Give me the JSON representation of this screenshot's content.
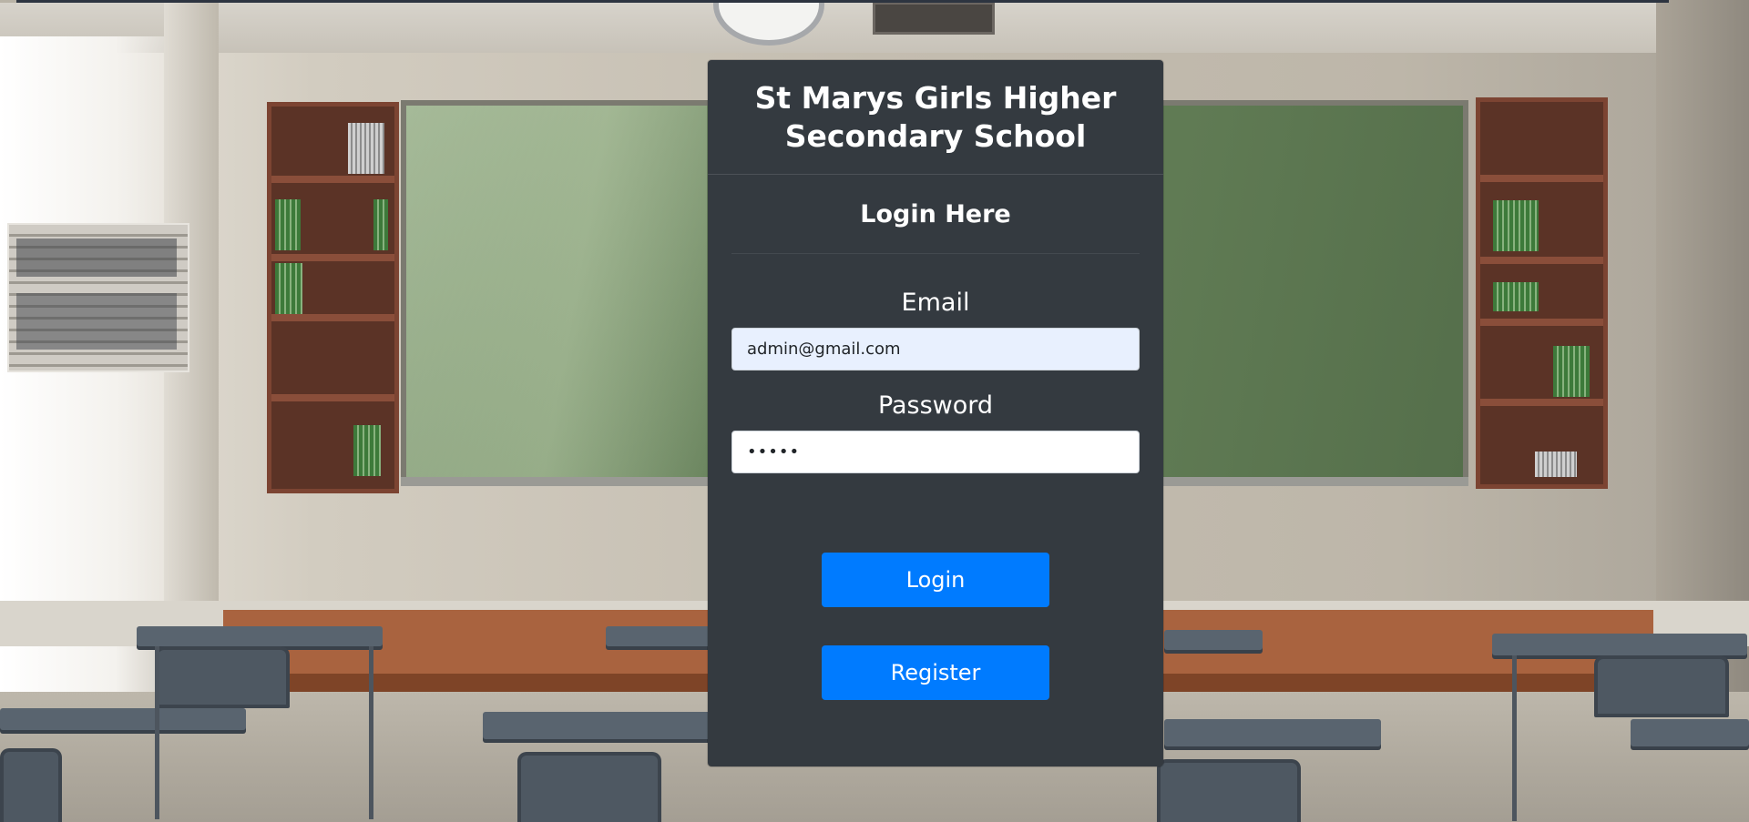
{
  "header": {
    "school_name": "St Marys Girls Higher Secondary School"
  },
  "login": {
    "heading": "Login Here",
    "email_label": "Email",
    "email_value": "admin@gmail.com",
    "password_label": "Password",
    "password_value": "•••••",
    "login_button": "Login",
    "register_button": "Register"
  },
  "colors": {
    "card_background": "#343a40",
    "button_primary": "#007bff",
    "email_autofill_background": "#e8f0fe"
  }
}
